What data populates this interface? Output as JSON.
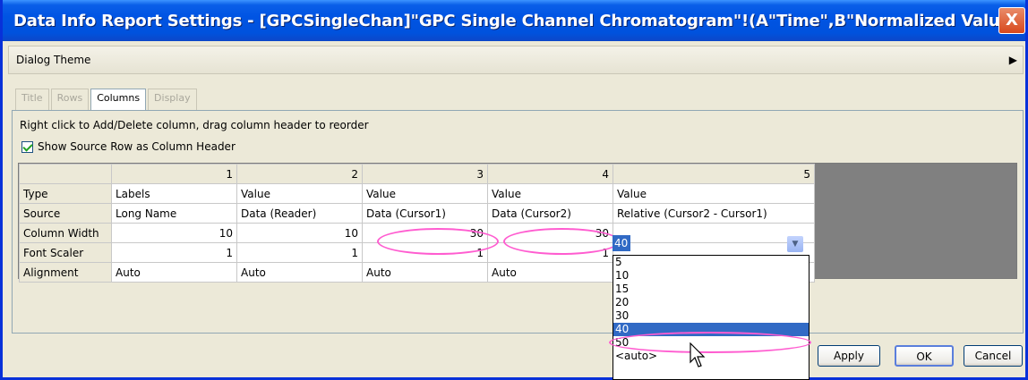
{
  "window": {
    "title": "Data Info Report Settings - [GPCSingleChan]\"GPC Single Channel Chromatogram\"!(A\"Time\",B\"Normalized Value\")",
    "close_label": "X"
  },
  "theme_bar": {
    "label": "Dialog Theme",
    "arrow": "▶"
  },
  "tabs": [
    {
      "label": "Title",
      "active": false
    },
    {
      "label": "Rows",
      "active": false
    },
    {
      "label": "Columns",
      "active": true
    },
    {
      "label": "Display",
      "active": false
    }
  ],
  "panel": {
    "hint": "Right click to Add/Delete column, drag column header to reorder",
    "checkbox_label": "Show Source Row as Column Header",
    "checkbox_checked": true
  },
  "grid": {
    "column_headers": [
      "1",
      "2",
      "3",
      "4",
      "5"
    ],
    "rows": [
      {
        "label": "Type",
        "cells": [
          "Labels",
          "Value",
          "Value",
          "Value",
          "Value"
        ]
      },
      {
        "label": "Source",
        "cells": [
          "Long Name",
          "Data (Reader)",
          "Data (Cursor1)",
          "Data (Cursor2)",
          "Relative (Cursor2 - Cursor1)"
        ]
      },
      {
        "label": "Column Width",
        "cells": [
          "10",
          "10",
          "30",
          "30",
          ""
        ]
      },
      {
        "label": "Font Scaler",
        "cells": [
          "1",
          "1",
          "1",
          "1",
          ""
        ]
      },
      {
        "label": "Alignment",
        "cells": [
          "Auto",
          "Auto",
          "Auto",
          "Auto",
          ""
        ]
      }
    ]
  },
  "combo": {
    "value": "40",
    "options": [
      "5",
      "10",
      "15",
      "20",
      "30",
      "40",
      "50",
      "<auto>"
    ],
    "selected_index": 5
  },
  "buttons": {
    "apply": "Apply",
    "ok": "OK",
    "cancel": "Cancel"
  },
  "colors": {
    "titlebar": "#0054e3",
    "highlight": "#316ac5",
    "annotation": "#ff5cd0"
  }
}
